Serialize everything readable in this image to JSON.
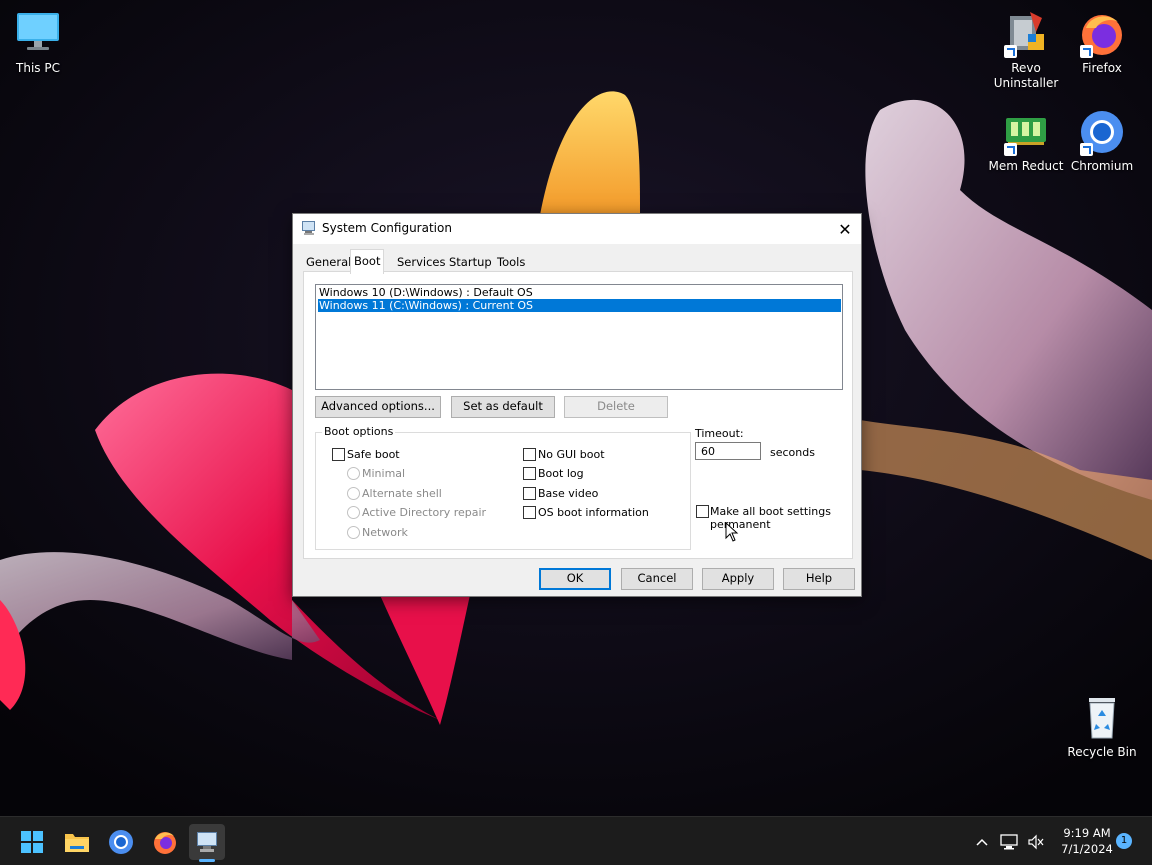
{
  "desktop": {
    "icons": [
      {
        "label": "This PC"
      },
      {
        "label_line1": "Revo",
        "label_line2": "Uninstaller"
      },
      {
        "label": "Firefox"
      },
      {
        "label": "Mem Reduct"
      },
      {
        "label": "Chromium"
      },
      {
        "label": "Recycle Bin"
      }
    ]
  },
  "dialog": {
    "title": "System Configuration",
    "close_glyph": "✕",
    "tabs": [
      {
        "label": "General"
      },
      {
        "label": "Boot"
      },
      {
        "label": "Services"
      },
      {
        "label": "Startup"
      },
      {
        "label": "Tools"
      }
    ],
    "active_tab": "Boot",
    "os_entries": [
      {
        "text": "Windows 10 (D:\\Windows) : Default OS",
        "selected": false
      },
      {
        "text": "Windows 11 (C:\\Windows) : Current OS",
        "selected": true
      }
    ],
    "buttons": {
      "advanced": "Advanced options...",
      "set_default": "Set as default",
      "delete": "Delete"
    },
    "boot_options": {
      "legend": "Boot options",
      "safe_boot": "Safe boot",
      "minimal": "Minimal",
      "alternate_shell": "Alternate shell",
      "ad_repair": "Active Directory repair",
      "network": "Network",
      "no_gui": "No GUI boot",
      "boot_log": "Boot log",
      "base_video": "Base video",
      "os_boot_info": "OS boot information"
    },
    "timeout": {
      "label": "Timeout:",
      "value": "60",
      "unit": "seconds"
    },
    "permanent": {
      "line1": "Make all boot settings",
      "line2": "permanent"
    },
    "footer": {
      "ok": "OK",
      "cancel": "Cancel",
      "apply": "Apply",
      "help": "Help"
    }
  },
  "taskbar": {
    "time": "9:19 AM",
    "date": "7/1/2024",
    "notification_count": "1",
    "tray_chevron": "^"
  },
  "colors": {
    "accent": "#0078d7",
    "taskbar": "#1c1c1c",
    "selection": "#0078d7"
  }
}
